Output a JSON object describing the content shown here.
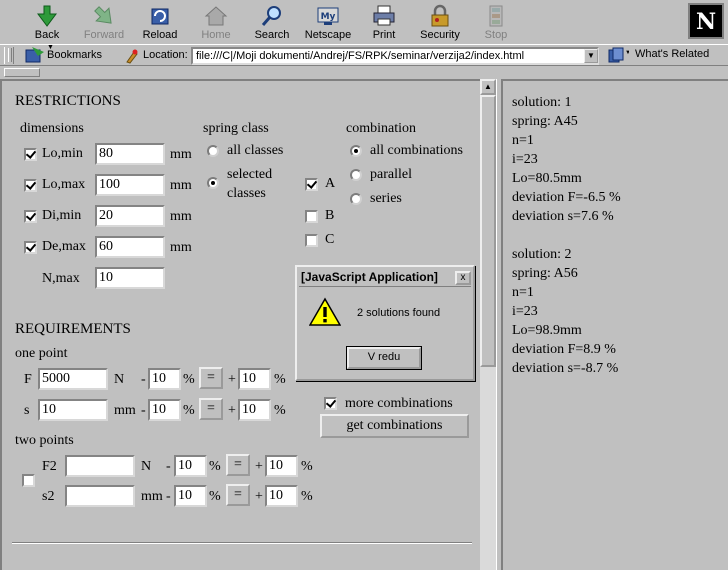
{
  "toolbar": {
    "back": "Back",
    "forward": "Forward",
    "reload": "Reload",
    "home": "Home",
    "search": "Search",
    "netscape": "Netscape",
    "print": "Print",
    "security": "Security",
    "stop": "Stop",
    "mylabel": "My"
  },
  "logo": "N",
  "location": {
    "bookmarks": "Bookmarks",
    "label": "Location:",
    "url": "file:///C|/Moji dokumenti/Andrej/FS/RPK/seminar/verzija2/index.html",
    "whats_related": "What's Related"
  },
  "restrictions": {
    "title": "RESTRICTIONS",
    "dimensions": "dimensions",
    "lo_min_label": "Lo,min",
    "lo_min": "80",
    "lo_max_label": "Lo,max",
    "lo_max": "100",
    "di_min_label": "Di,min",
    "di_min": "20",
    "de_max_label": "De,max",
    "de_max": "60",
    "n_max_label": "N,max",
    "n_max": "10",
    "unit": "mm"
  },
  "spring_class": {
    "title": "spring class",
    "all": "all classes",
    "selected": "selected",
    "selected2": "classes",
    "a": "A",
    "b": "B",
    "c": "C"
  },
  "combination": {
    "title": "combination",
    "all": "all combinations",
    "parallel": "parallel",
    "series": "series"
  },
  "requirements": {
    "title": "REQUIREMENTS",
    "one_point": "one point",
    "f_label": "F",
    "f_value": "5000",
    "f_unit": "N",
    "f_minus": "10",
    "f_plus": "10",
    "s_label": "s",
    "s_value": "10",
    "s_unit": "mm",
    "s_minus": "10",
    "s_plus": "10",
    "two_points": "two points",
    "f2_label": "F2",
    "f2_value": "",
    "f2_unit": "N",
    "f2_minus": "10",
    "f2_plus": "10",
    "s2_label": "s2",
    "s2_value": "",
    "s2_unit": "mm",
    "s2_minus": "10",
    "s2_plus": "10",
    "minus": "-",
    "plus": "+",
    "percent": "%",
    "equals": "=",
    "more_combinations": "more combinations",
    "get_combinations": "get combinations"
  },
  "dialog": {
    "title": "[JavaScript Application]",
    "message": "2 solutions found",
    "ok": "V redu",
    "close": "x"
  },
  "solutions": [
    "solution: 1",
    "spring: A45",
    "n=1",
    "i=23",
    "Lo=80.5mm",
    "deviation F=-6.5 %",
    "deviation s=7.6 %",
    "",
    "solution: 2",
    "spring: A56",
    "n=1",
    "i=23",
    "Lo=98.9mm",
    "deviation F=8.9 %",
    "deviation s=-8.7 %"
  ]
}
